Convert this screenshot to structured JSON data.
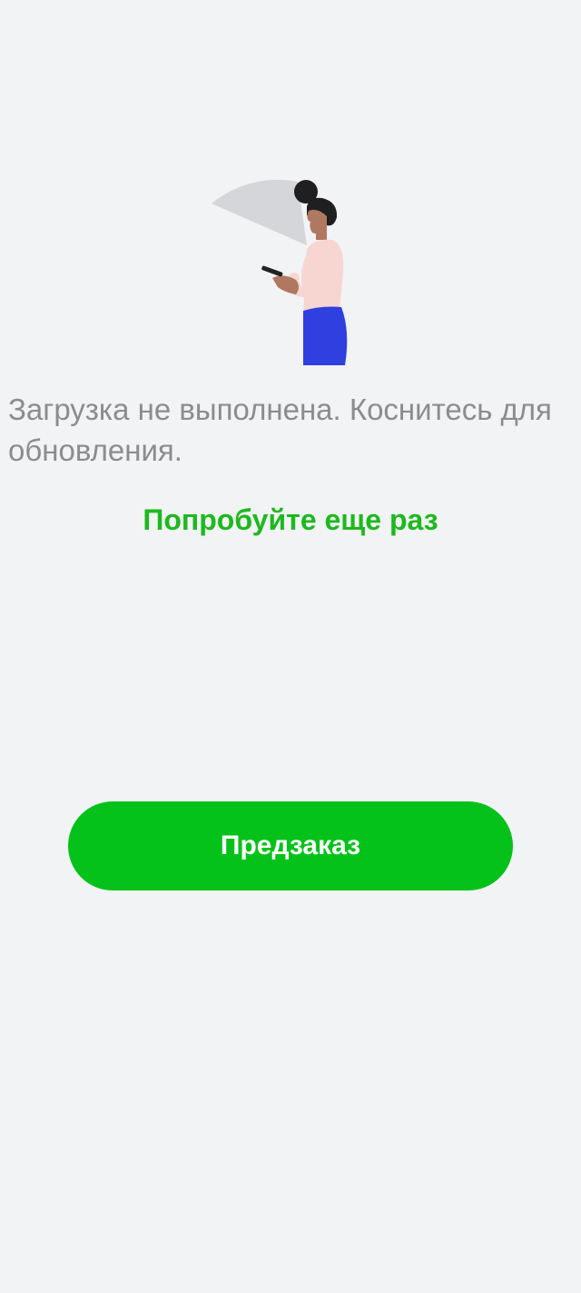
{
  "error": {
    "message": "Загрузка не выполнена. Коснитесь для обновления.",
    "illustration": "woman-with-phone-no-signal-illustration"
  },
  "retry": {
    "label": "Попробуйте еще раз"
  },
  "preorder": {
    "label": "Предзаказ"
  },
  "colors": {
    "background": "#f2f3f5",
    "accent_green": "#05c21a",
    "link_green": "#1db91d",
    "message_gray": "#8c8c8c",
    "skirt_blue": "#2f3fe0"
  }
}
